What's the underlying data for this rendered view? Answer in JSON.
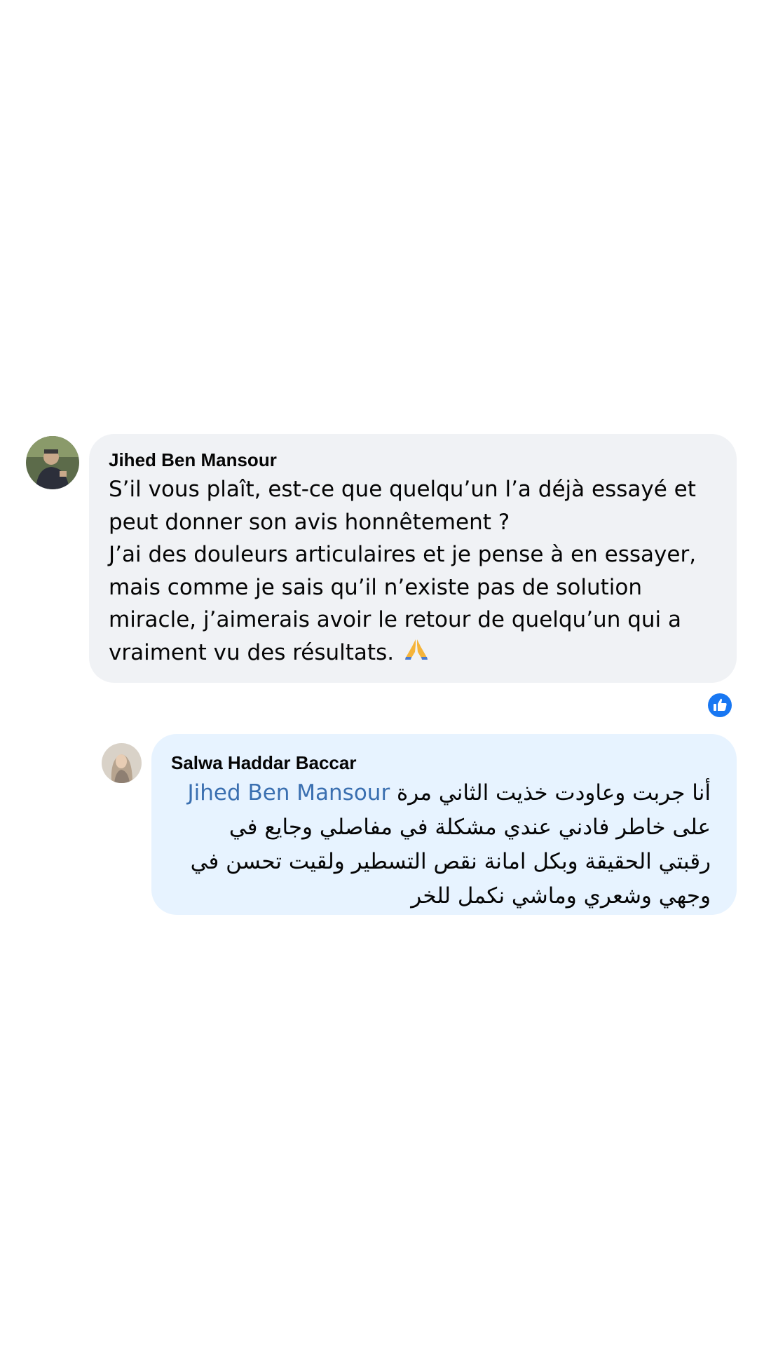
{
  "comment": {
    "author": "Jihed Ben Mansour",
    "text": "S’il vous plaît, est-ce que quelqu’un l’a déjà essayé et\npeut donner son avis honnêtement ?\nJ’ai des douleurs articulaires et je pense à en essayer,\nmais comme je sais qu’il n’existe pas de solution\nmiracle, j’aimerais avoir le retour de quelqu’un qui a\nvraiment vu des résultats.",
    "emoji": "folded-hands-emoji",
    "reaction_icon": "like-icon",
    "reaction_color": "#1877f2",
    "bubble_color": "#f0f2f5"
  },
  "reply": {
    "author": "Salwa Haddar Baccar",
    "mention": "Jihed Ben Mansour",
    "text": "أنا جربت وعاودت خذيت الثاني مرة على خاطر فادني عندي مشكلة في مفاصلي وجايع في رقبتي الحقيقة وبكل امانة نقص التسطير ولقيت تحسن في وجهي وشعري وماشي نكمل للخر",
    "bubble_color": "#e7f3ff",
    "mention_color": "#3a6fb0"
  }
}
